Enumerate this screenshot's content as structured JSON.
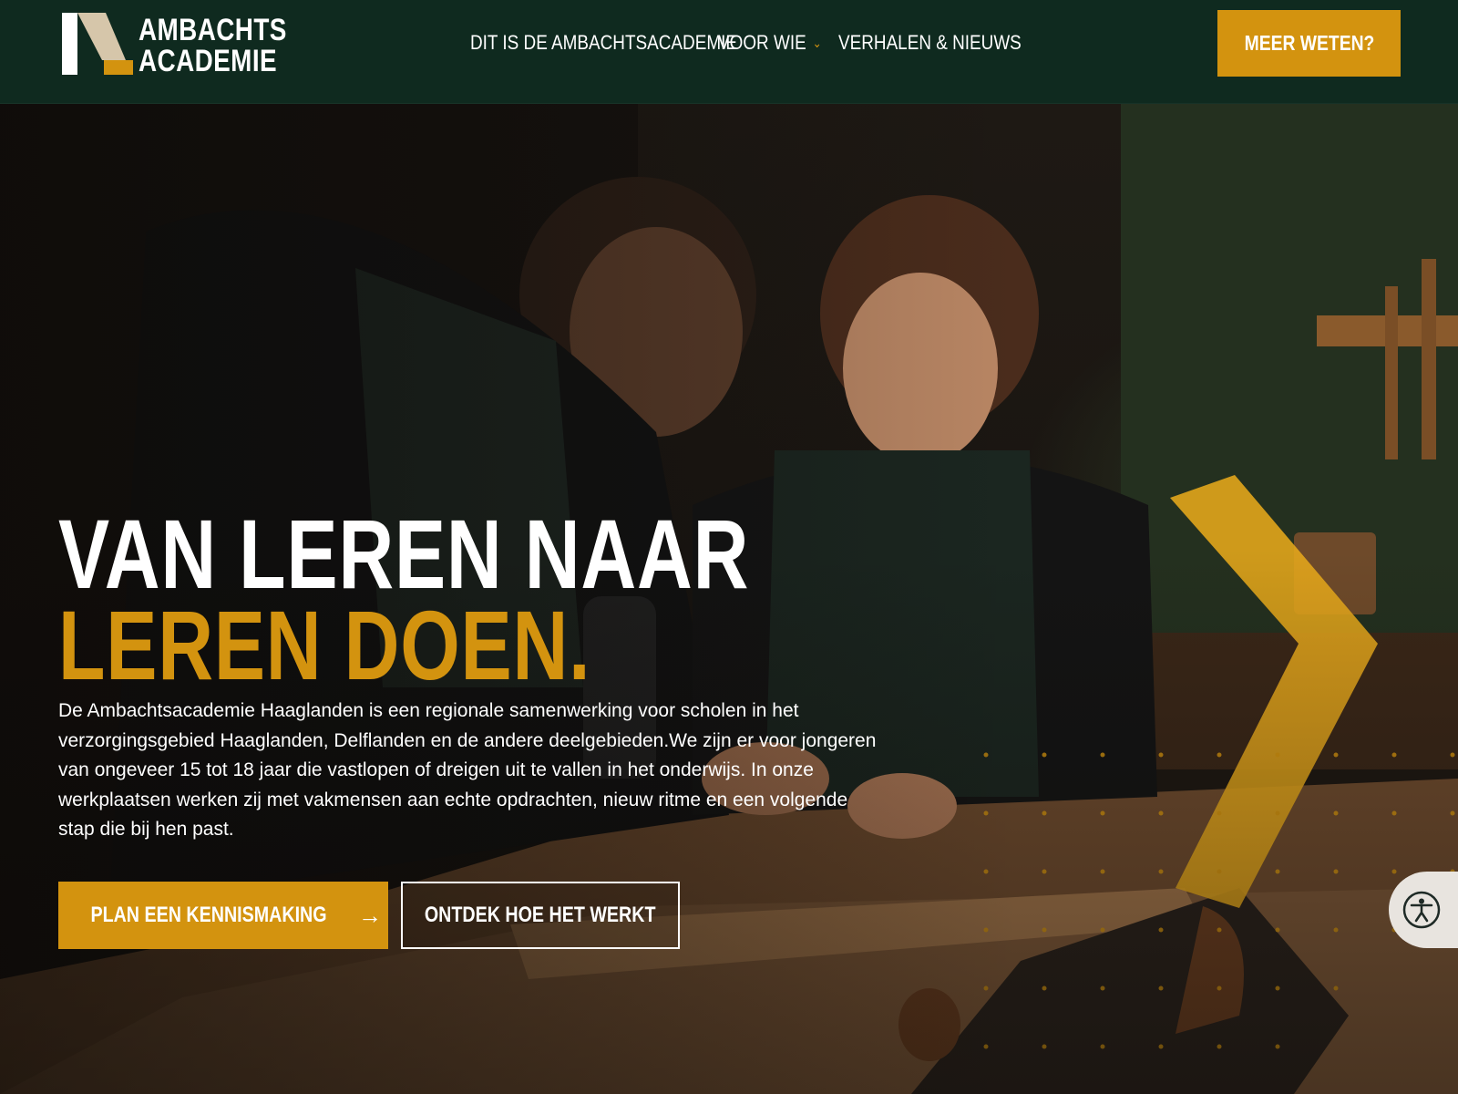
{
  "header": {
    "logo": {
      "line1": "AMBACHTS",
      "line2": "ACADEMIE"
    },
    "nav": [
      {
        "label": "DIT IS DE AMBACHTSACADEMIE"
      },
      {
        "label": "VOOR WIE",
        "has_dropdown": true
      },
      {
        "label": "VERHALEN & NIEUWS"
      }
    ],
    "cta": "MEER WETEN?"
  },
  "hero": {
    "headline_line1": "VAN LEREN NAAR",
    "headline_line2": "LEREN DOEN.",
    "intro": "De Ambachtsacademie Haaglanden is een regionale samenwerking voor scholen in het\nverzorgingsgebied Haaglanden, Delflanden en de andere deelgebieden.We zijn er voor jongeren\nvan ongeveer 15 tot 18 jaar die vastlopen of dreigen uit te vallen in het onderwijs. In onze\nwerkplaatsen werken zij met vakmensen aan echte opdrachten, nieuw ritme en een volgende\nstap die bij hen past.",
    "primary_button": "PLAN EEN KENNISMAKING",
    "primary_button_icon": "arrow-right-icon",
    "secondary_button": "ONTDEK HOE HET WERKT"
  },
  "accessibility_widget": {
    "icon": "accessibility-icon"
  },
  "colors": {
    "header_bg": "#0f2a1f",
    "accent": "#d3930f",
    "text": "#ffffff"
  }
}
